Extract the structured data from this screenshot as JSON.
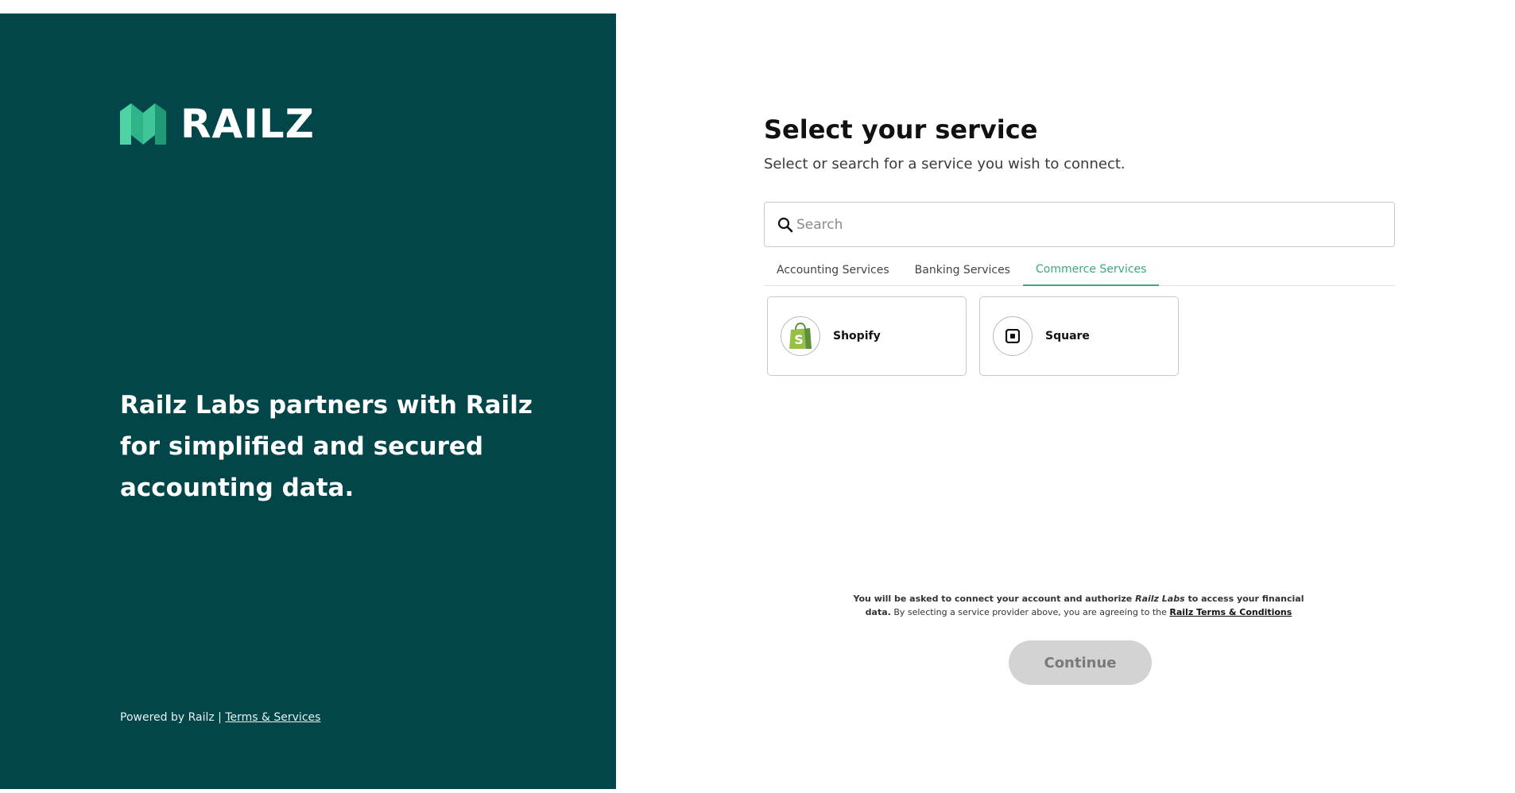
{
  "brand": {
    "logo_text": "RAILZ",
    "tagline": "Railz Labs partners with Railz for simplified and secured accounting data.",
    "colors": {
      "panel_bg": "#024649",
      "accent": "#3aa784",
      "logo_green_light": "#4fd3a4",
      "logo_green_dark": "#1f9a76"
    }
  },
  "footer": {
    "powered_text": "Powered by Railz | ",
    "terms_link": "Terms & Services"
  },
  "main": {
    "title": "Select your service",
    "subtitle": "Select or search for a service you wish to connect.",
    "search": {
      "placeholder": "Search",
      "icon": "search-icon"
    },
    "tabs": [
      {
        "label": "Accounting Services",
        "active": false
      },
      {
        "label": "Banking Services",
        "active": false
      },
      {
        "label": "Commerce Services",
        "active": true
      }
    ],
    "services": [
      {
        "label": "Shopify",
        "icon": "shopify-bag-icon"
      },
      {
        "label": "Square",
        "icon": "square-icon"
      }
    ],
    "disclaimer": {
      "part1": "You will be asked to connect your account and authorize ",
      "company": "Railz Labs",
      "part2": " to access your financial data.",
      "part3": " By selecting a service provider above, you are agreeing to the ",
      "terms_link": "Railz Terms & Conditions"
    },
    "continue_label": "Continue"
  }
}
